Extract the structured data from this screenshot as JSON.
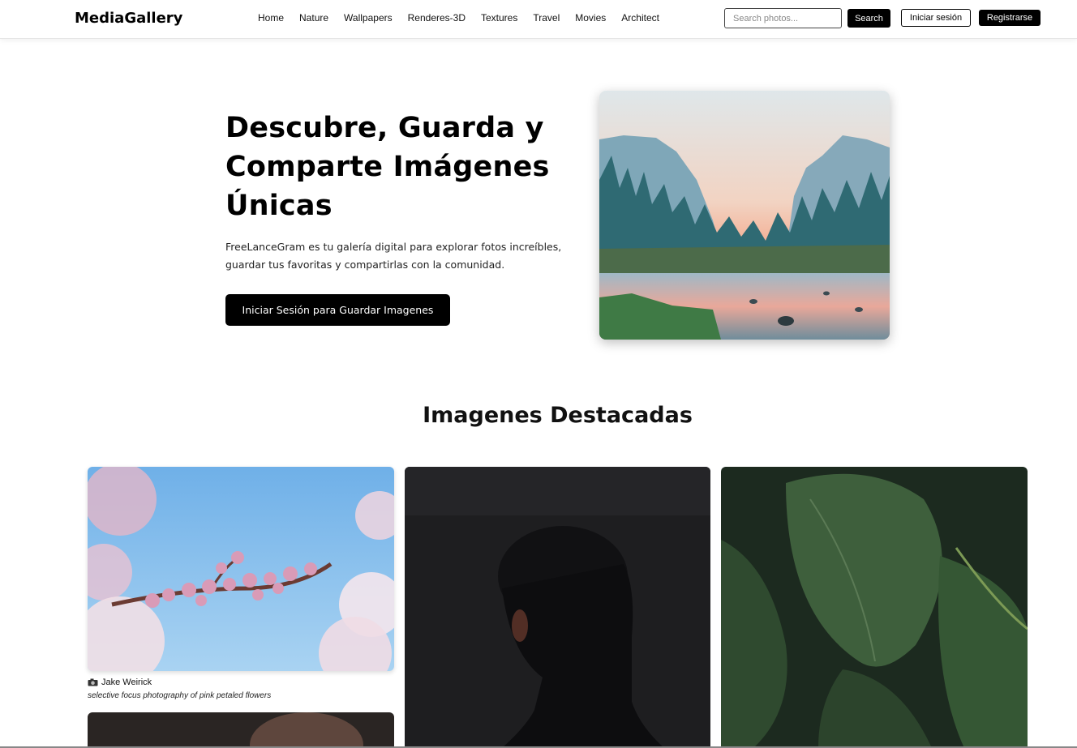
{
  "header": {
    "logo": "MediaGallery",
    "nav": [
      "Home",
      "Nature",
      "Wallpapers",
      "Renderes-3D",
      "Textures",
      "Travel",
      "Movies",
      "Architect"
    ],
    "search_placeholder": "Search photos...",
    "search_label": "Search",
    "login_label": "Iniciar sesión",
    "register_label": "Registrarse"
  },
  "hero": {
    "title": "Descubre, Guarda y Comparte Imágenes Únicas",
    "description": "FreeLanceGram es tu galería digital para explorar fotos increíbles, guardar tus favoritas y compartirlas con la comunidad.",
    "cta_label": "Iniciar Sesión para Guardar Imagenes"
  },
  "featured": {
    "title": "Imagenes Destacadas",
    "cards": [
      {
        "author": "Jake Weirick",
        "description": "selective focus photography of pink petaled flowers"
      }
    ]
  },
  "colors": {
    "primary": "#000000",
    "background": "#ffffff"
  },
  "icons": {
    "camera": "camera-icon"
  }
}
